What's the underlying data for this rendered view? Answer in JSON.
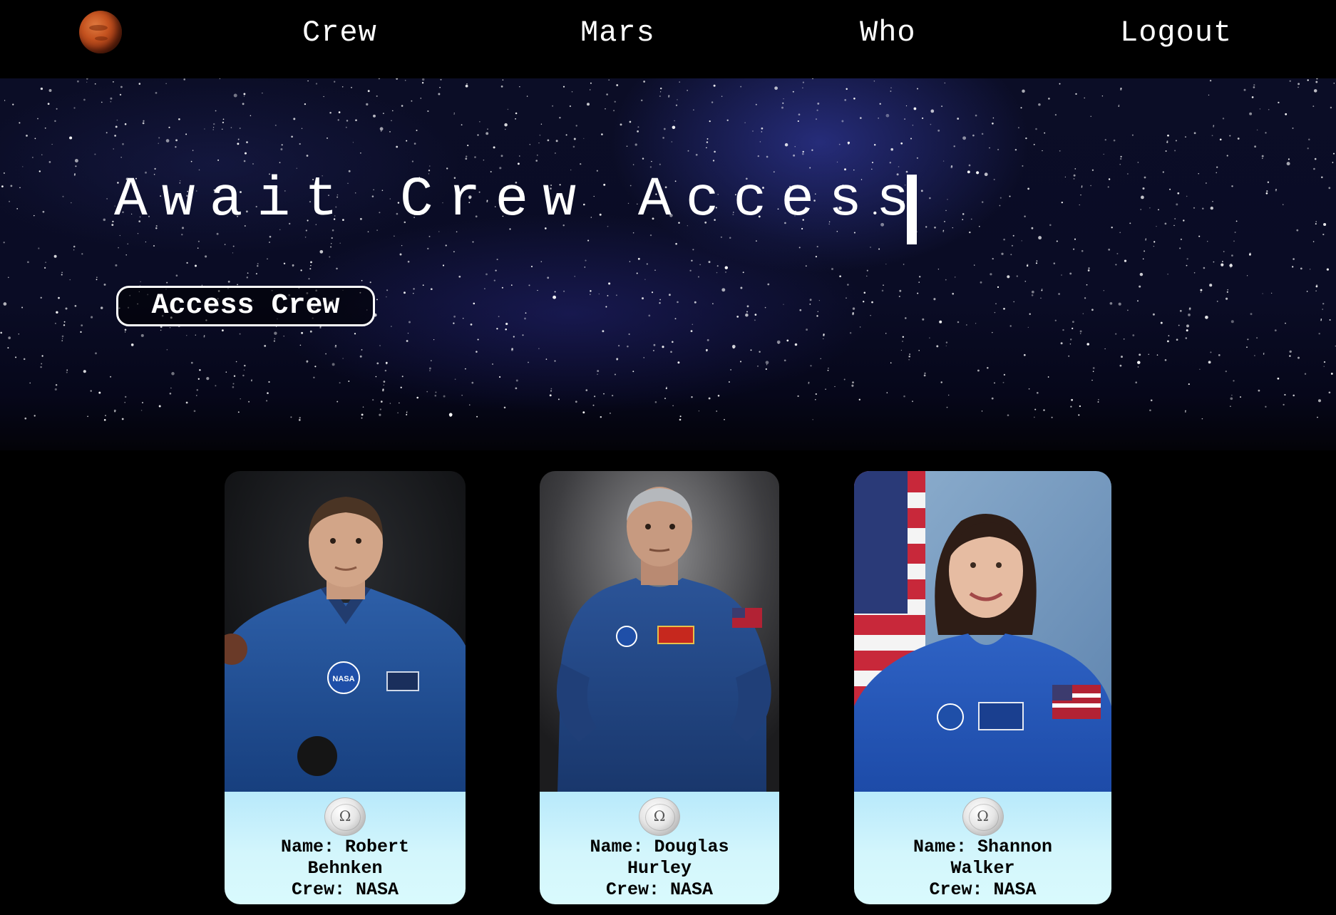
{
  "nav": {
    "logo_icon": "mars-planet-icon",
    "links": [
      "Crew",
      "Mars",
      "Who",
      "Logout"
    ]
  },
  "hero": {
    "title": "Await Crew Access",
    "button_label": "Access Crew"
  },
  "crew": [
    {
      "name_line": "Name: Robert",
      "surname_line": "Behnken",
      "crew_line": "Crew: NASA",
      "icon": "wikipedia-globe-icon"
    },
    {
      "name_line": "Name: Douglas",
      "surname_line": "Hurley",
      "crew_line": "Crew: NASA",
      "icon": "wikipedia-globe-icon"
    },
    {
      "name_line": "Name: Shannon",
      "surname_line": "Walker",
      "crew_line": "Crew: NASA",
      "icon": "wikipedia-globe-icon"
    }
  ],
  "colors": {
    "background": "#000000",
    "card_info_bg": "#d3f6fc",
    "nav_text": "#ffffff"
  }
}
